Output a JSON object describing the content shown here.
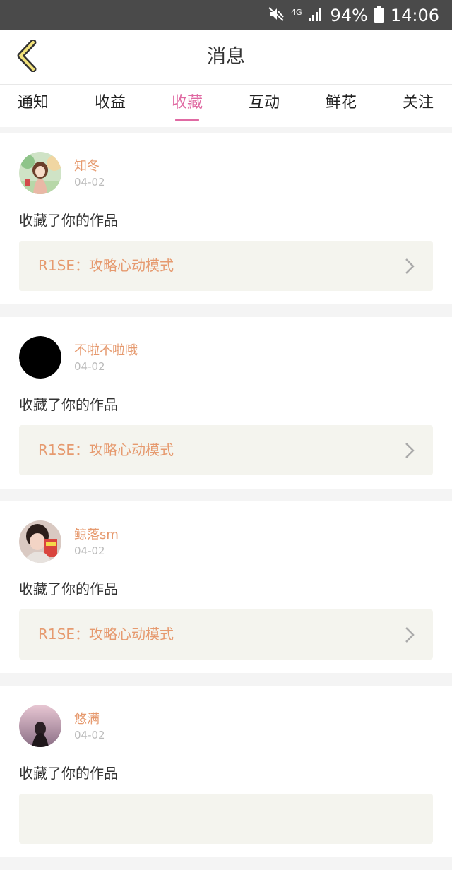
{
  "status_bar": {
    "network": "4G",
    "battery": "94%",
    "time": "14:06"
  },
  "header": {
    "title": "消息"
  },
  "tabs": [
    {
      "label": "通知",
      "active": false
    },
    {
      "label": "收益",
      "active": false
    },
    {
      "label": "收藏",
      "active": true
    },
    {
      "label": "互动",
      "active": false
    },
    {
      "label": "鲜花",
      "active": false
    },
    {
      "label": "关注",
      "active": false
    }
  ],
  "colors": {
    "accent": "#e06aa3",
    "name": "#e69a6f",
    "work_bg": "#f4f4ee"
  },
  "notifications": [
    {
      "user": "知冬",
      "date": "04-02",
      "action": "收藏了你的作品",
      "work": "R1SE：攻略心动模式",
      "avatar": "illustrated-girl"
    },
    {
      "user": "不啦不啦哦",
      "date": "04-02",
      "action": "收藏了你的作品",
      "work": "R1SE：攻略心动模式",
      "avatar": "black-circle"
    },
    {
      "user": "鲸落sm",
      "date": "04-02",
      "action": "收藏了你的作品",
      "work": "R1SE：攻略心动模式",
      "avatar": "girl-photo"
    },
    {
      "user": "悠满",
      "date": "04-02",
      "action": "收藏了你的作品",
      "work": "",
      "avatar": "pink-sky-photo"
    }
  ]
}
